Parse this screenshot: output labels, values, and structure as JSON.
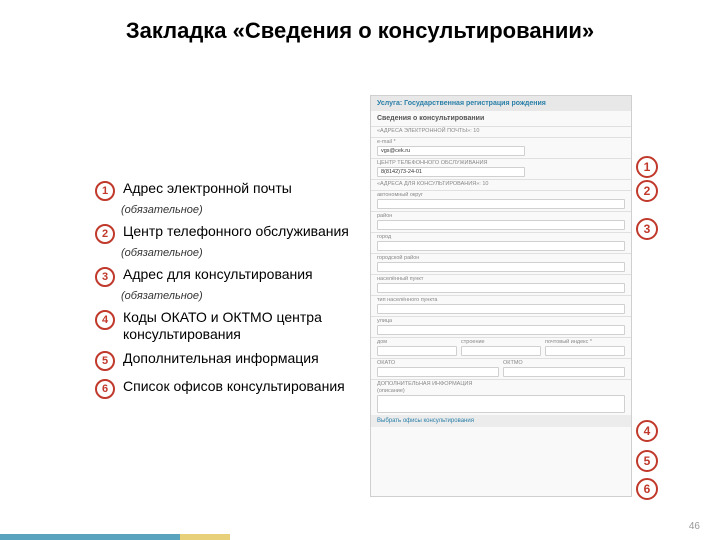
{
  "title": "Закладка «Сведения о консультировании»",
  "legend": [
    {
      "num": "1",
      "text": "Адрес электронной почты",
      "optional": true
    },
    {
      "num": "2",
      "text": "Центр телефонного обслуживания",
      "optional": true
    },
    {
      "num": "3",
      "text": "Адрес для консультирования",
      "optional": true
    },
    {
      "num": "4",
      "text": "Коды ОКАТО и ОКТМО центра консультирования",
      "optional": false
    },
    {
      "num": "5",
      "text": "Дополнительная информация",
      "optional": false
    },
    {
      "num": "6",
      "text": "Список офисов консультирования",
      "optional": false
    }
  ],
  "optional_label": "(обязательное)",
  "screenshot": {
    "service": "Услуга: Государственная регистрация рождения",
    "section": "Сведения о консультировании",
    "fields": {
      "count_label": "«АДРЕСА ЭЛЕКТРОННОЙ ПОЧТЫ»: 10",
      "email_label": "e-mail *",
      "email_value": "vgs@cek.ru",
      "phone_label": "ЦЕНТР ТЕЛЕФОННОГО ОБСЛУЖИВАНИЯ",
      "phone_value": "8(8142)73-24-01",
      "addr_label": "«АДРЕСА ДЛЯ КОНСУЛЬТИРОВАНИЯ»: 10",
      "region_label": "автономный округ",
      "region_value": "",
      "district_label": "район",
      "district_value": "",
      "city_label": "город",
      "city_value": "",
      "urban_label": "городской район",
      "urban_value": "",
      "settlement_label": "населённый пункт",
      "settlement_value": "",
      "place_label": "тип населённого пункта",
      "place_value": "",
      "street_label": "улица",
      "street_value": "",
      "house_label": "дом",
      "building_label": "строение",
      "index_label": "почтовый индекс *",
      "okato_label": "ОКАТО",
      "oktmo_label": "ОКТМО",
      "extra_label": "ДОПОЛНИТЕЛЬНАЯ ИНФОРМАЦИЯ",
      "extra_sub": "(описание)",
      "offices": "Выбрать офисы консультирования"
    }
  },
  "markers": [
    "1",
    "2",
    "3",
    "4",
    "5",
    "6"
  ],
  "page_number": "46"
}
